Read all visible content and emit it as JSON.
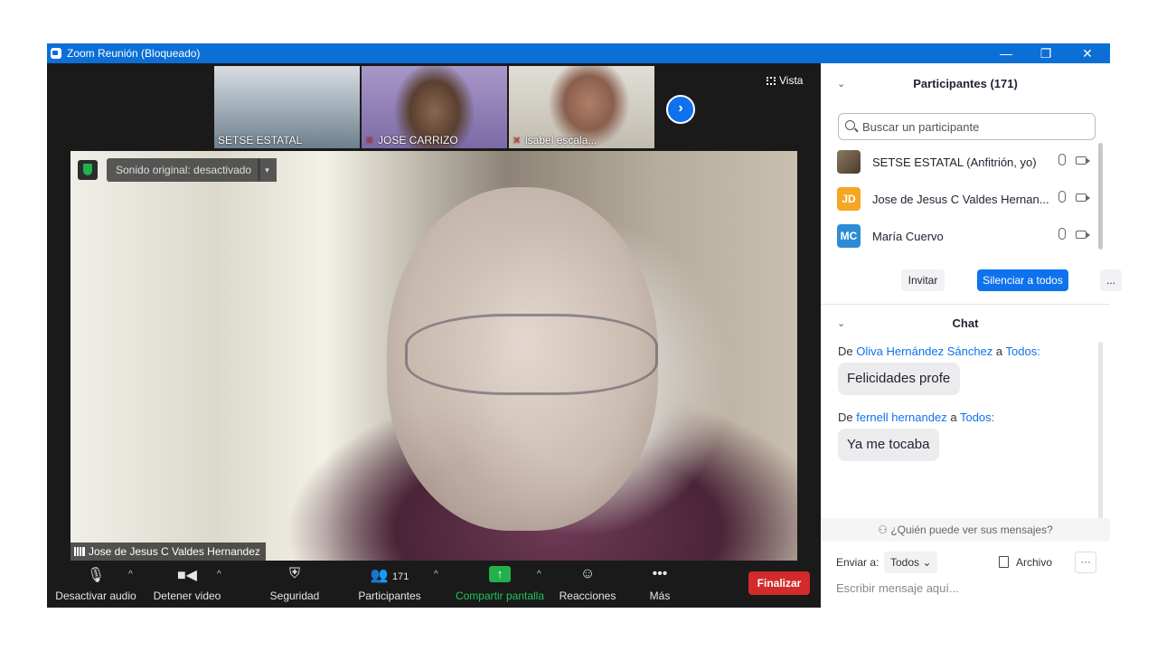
{
  "window": {
    "title": "Zoom Reunión (Bloqueado)",
    "min": "—",
    "restore": "❐",
    "close": "✕"
  },
  "gallery": {
    "thumbnails": [
      {
        "name": "SETSE ESTATAL",
        "muted": false
      },
      {
        "name": "JOSE CARRIZO",
        "muted": true
      },
      {
        "name": "isabel escala...",
        "muted": true
      }
    ],
    "next": "›",
    "view_label": "Vista"
  },
  "main_video": {
    "sound_label": "Sonido original: desactivado",
    "sound_caret": "▾",
    "speaker_name": "Jose de Jesus C Valdes Hernandez"
  },
  "toolbar": {
    "audio_label": "Desactivar audio",
    "video_label": "Detener video",
    "security_label": "Seguridad",
    "participants_label": "Participantes",
    "participants_count": "171",
    "share_label": "Compartir pantalla",
    "reactions_label": "Reacciones",
    "more_label": "Más",
    "end_label": "Finalizar",
    "caret": "^",
    "colors": {
      "share": "#22b14c",
      "end": "#d32a2a"
    }
  },
  "participants_panel": {
    "title": "Participantes (171)",
    "search_placeholder": "Buscar un participante",
    "collapse": "⌄",
    "people": [
      {
        "initials": "",
        "name": "SETSE ESTATAL (Anfitrión, yo)",
        "color": "#6b5a43"
      },
      {
        "initials": "JD",
        "name": "Jose de Jesus C Valdes Hernan...",
        "color": "#f5a623"
      },
      {
        "initials": "MC",
        "name": "María Cuervo",
        "color": "#2d8cd6"
      }
    ],
    "invite_label": "Invitar",
    "mute_all_label": "Silenciar a todos",
    "more_label": "..."
  },
  "chat_panel": {
    "title": "Chat",
    "collapse": "⌄",
    "messages": [
      {
        "prefix": "De",
        "sender": "Oliva Hernández Sánchez",
        "to_word": "a",
        "recipient": "Todos:",
        "text": "Felicidades profe"
      },
      {
        "prefix": "De",
        "sender": "fernell hernandez",
        "to_word": "a",
        "recipient": "Todos:",
        "text": "Ya me tocaba"
      }
    ],
    "who_can_see": "¿Quién puede ver sus mensajes?",
    "send_to_label": "Enviar a:",
    "send_to_value": "Todos",
    "file_label": "Archivo",
    "more": "···",
    "input_placeholder": "Escribir mensaje aquí..."
  }
}
